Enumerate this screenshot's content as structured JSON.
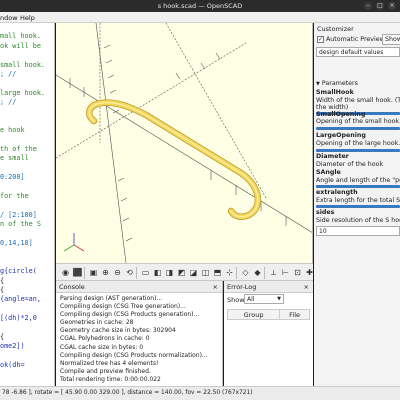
{
  "window": {
    "title": "s hook.scad — OpenSCAD"
  },
  "menu": {
    "window": "ndow",
    "help": "Help"
  },
  "editor": {
    "lines": [
      {
        "text": "",
        "cls": "c-tx"
      },
      {
        "text": "mall hook.",
        "cls": "c-cm"
      },
      {
        "text": "ok will be",
        "cls": "c-cm"
      },
      {
        "text": "",
        "cls": "c-tx"
      },
      {
        "text": "small hook.",
        "cls": "c-cm"
      },
      {
        "text": "; //",
        "cls": "c-nm"
      },
      {
        "text": "",
        "cls": "c-tx"
      },
      {
        "text": "large hook.",
        "cls": "c-cm"
      },
      {
        "text": "; //",
        "cls": "c-nm"
      },
      {
        "text": "",
        "cls": "c-tx"
      },
      {
        "text": "",
        "cls": "c-tx"
      },
      {
        "text": "e hook",
        "cls": "c-cm"
      },
      {
        "text": "",
        "cls": "c-tx"
      },
      {
        "text": "th of the",
        "cls": "c-cm"
      },
      {
        "text": "e small",
        "cls": "c-cm"
      },
      {
        "text": "",
        "cls": "c-tx"
      },
      {
        "text": "0:200]",
        "cls": "c-nm"
      },
      {
        "text": "",
        "cls": "c-tx"
      },
      {
        "text": "for the",
        "cls": "c-cm"
      },
      {
        "text": "",
        "cls": "c-tx"
      },
      {
        "text": "/ [2:100]",
        "cls": "c-nm"
      },
      {
        "text": "n of the S",
        "cls": "c-cm"
      },
      {
        "text": "",
        "cls": "c-tx"
      },
      {
        "text": "0,14,18]",
        "cls": "c-nm"
      },
      {
        "text": "",
        "cls": "c-tx"
      },
      {
        "text": "",
        "cls": "c-tx"
      },
      {
        "text": "g{circle(",
        "cls": "c-kw"
      },
      {
        "text": "{",
        "cls": "c-tx"
      },
      {
        "text": "{",
        "cls": "c-tx"
      },
      {
        "text": "{angle=an,",
        "cls": "c-kw"
      },
      {
        "text": "",
        "cls": "c-tx"
      },
      {
        "text": "[(dh)*2,0",
        "cls": "c-kw"
      },
      {
        "text": "",
        "cls": "c-tx"
      },
      {
        "text": "{",
        "cls": "c-tx"
      },
      {
        "text": "ome2])",
        "cls": "c-kw"
      },
      {
        "text": "",
        "cls": "c-tx"
      },
      {
        "text": "ok(dh=",
        "cls": "c-kw"
      }
    ]
  },
  "toolbar": {
    "icons": [
      "preview-icon",
      "render-icon",
      "view-all-icon",
      "zoom-in-icon",
      "zoom-out-icon",
      "reset-view-icon",
      "view-right-icon",
      "view-top-icon",
      "view-bottom-icon",
      "view-left-icon",
      "view-front-icon",
      "view-back-icon",
      "view-diagonal-icon",
      "view-center-icon",
      "perspective-icon",
      "orthogonal-icon",
      "axes-icon",
      "scale-markers-icon",
      "edges-icon",
      "crosshairs-icon"
    ]
  },
  "console": {
    "title": "Console",
    "lines": [
      "Parsing design (AST generation)...",
      "Compiling design (CSG Tree generation)...",
      "Compiling design (CSG Products generation)...",
      "Geometries in cache: 28",
      "Geometry cache size in bytes: 302904",
      "CGAL Polyhedrons in cache: 0",
      "CGAL cache size in bytes: 0",
      "Compiling design (CSG Products normalization)...",
      "Normalized tree has 4 elements!",
      "Compile and preview finished.",
      "Total rendering time: 0:00:00.022"
    ]
  },
  "errorlog": {
    "title": "Error-Log",
    "show_label": "Show",
    "filter_value": "All",
    "col_group": "Group",
    "col_file": "File"
  },
  "customizer": {
    "title": "Customizer",
    "auto_preview_label": "Automatic Preview",
    "auto_preview_checked": "✓",
    "show_details_label": "Show Det",
    "preset_value": "design default values",
    "parameters_label": "Parameters",
    "params": [
      {
        "name": "SmallHook",
        "desc1": "Width of the small hook. (The la",
        "desc2": "the width)"
      },
      {
        "name": "SmallOpening",
        "desc1": "Opening of the small hook.",
        "desc2": ""
      },
      {
        "name": "LargeOpening",
        "desc1": "Opening of the large hook.",
        "desc2": ""
      },
      {
        "name": "Diameter",
        "desc1": "Diameter of the hook",
        "desc2": ""
      },
      {
        "name": "SAngle",
        "desc1": "Angle and length of the \"pull\" S",
        "desc2": ""
      },
      {
        "name": "extralength",
        "desc1": "Extra length for the total S hook.",
        "desc2": ""
      },
      {
        "name": "sides",
        "desc1": "Side resolution of the S hook.",
        "desc2": ""
      }
    ],
    "sides_value": "10"
  },
  "statusbar": {
    "text": "78 -6.86 ], rotate = [ 45.90 0.00 329.00 ], distance = 140.00, fov = 22.50 (767x721)"
  },
  "colors": {
    "viewport_bg": "#ffffe5",
    "model": "#f3d75c",
    "accent": "#3a78c2"
  }
}
